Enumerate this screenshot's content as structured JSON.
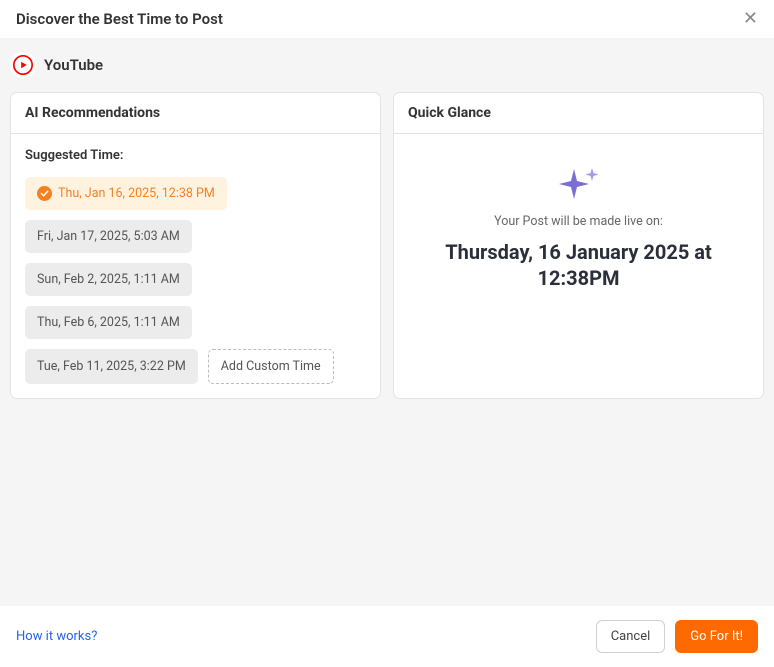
{
  "header": {
    "title": "Discover the Best Time to Post"
  },
  "platform": {
    "name": "YouTube"
  },
  "recommendations": {
    "title": "AI Recommendations",
    "suggested_label": "Suggested Time:",
    "times": [
      "Thu, Jan 16, 2025, 12:38 PM",
      "Fri, Jan 17, 2025, 5:03 AM",
      "Sun, Feb 2, 2025, 1:11 AM",
      "Thu, Feb 6, 2025, 1:11 AM",
      "Tue, Feb 11, 2025, 3:22 PM"
    ],
    "add_custom_label": "Add Custom Time"
  },
  "glance": {
    "title": "Quick Glance",
    "live_on_label": "Your Post will be made live on:",
    "live_time": "Thursday, 16 January 2025 at 12:38PM"
  },
  "footer": {
    "how_link": "How it works?",
    "cancel": "Cancel",
    "go": "Go For It!"
  }
}
